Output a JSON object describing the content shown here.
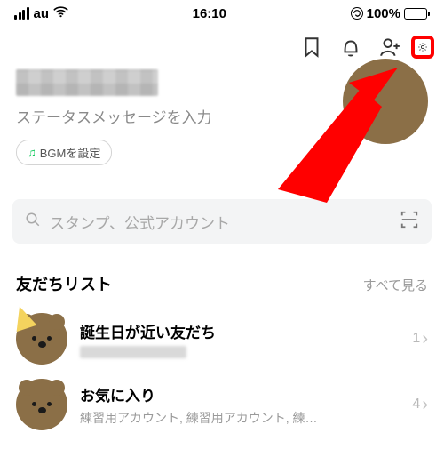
{
  "status_bar": {
    "carrier": "au",
    "time": "16:10",
    "battery_pct": "100%"
  },
  "profile": {
    "status_placeholder": "ステータスメッセージを入力",
    "bgm_label": "BGMを設定"
  },
  "search": {
    "placeholder": "スタンプ、公式アカウント"
  },
  "friends_section": {
    "title": "友だちリスト",
    "see_all": "すべて見る",
    "rows": [
      {
        "title": "誕生日が近い友だち",
        "subtitle": "",
        "count": "1"
      },
      {
        "title": "お気に入り",
        "subtitle": "練習用アカウント, 練習用アカウント, 練…",
        "count": "4"
      }
    ]
  }
}
